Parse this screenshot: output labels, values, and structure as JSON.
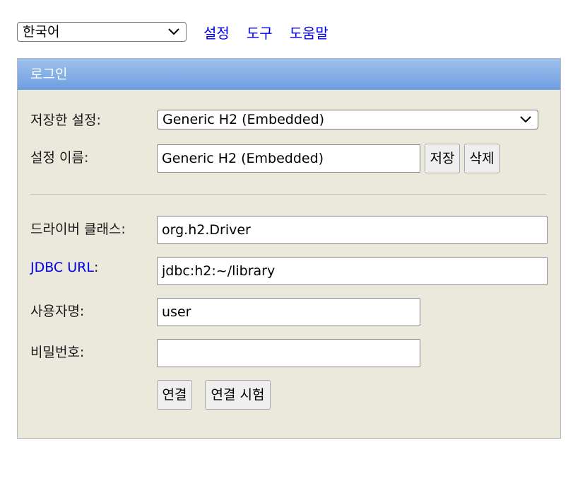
{
  "top": {
    "language": "한국어",
    "links": [
      "설정",
      "도구",
      "도움말"
    ]
  },
  "login": {
    "title": "로그인",
    "saved_settings_label": "저장한 설정:",
    "saved_settings_value": "Generic H2 (Embedded)",
    "setting_name_label": "설정 이름:",
    "setting_name_value": "Generic H2 (Embedded)",
    "save_button": "저장",
    "delete_button": "삭제",
    "driver_class_label": "드라이버 클래스:",
    "driver_class_value": "org.h2.Driver",
    "jdbc_url_label": "JDBC URL",
    "jdbc_url_suffix": ":",
    "jdbc_url_value": "jdbc:h2:~/library",
    "username_label": "사용자명:",
    "username_value": "user",
    "password_label": "비밀번호:",
    "password_value": "",
    "connect_button": "연결",
    "test_connection_button": "연결 시험"
  },
  "colors": {
    "header_gradient_top": "#9ec1ec",
    "header_gradient_bottom": "#6e9ee0",
    "panel_bg": "#ebe8dc",
    "link": "#0000ee"
  },
  "icons": {
    "dropdown": "chevron-down-icon"
  }
}
